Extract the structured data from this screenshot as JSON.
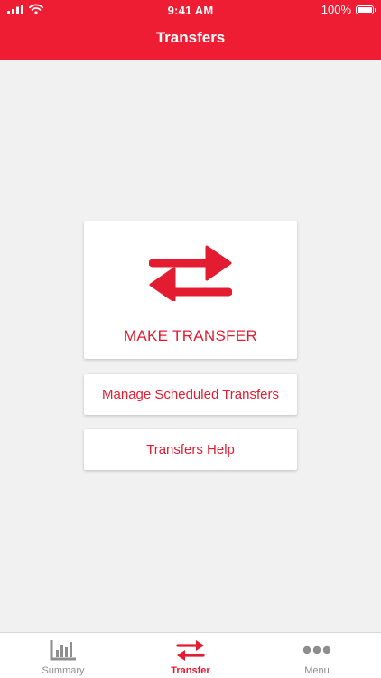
{
  "status_bar": {
    "time": "9:41 AM",
    "battery_text": "100%",
    "battery_level": 100
  },
  "header": {
    "title": "Transfers"
  },
  "actions": {
    "make_transfer": "MAKE TRANSFER",
    "manage_scheduled": "Manage Scheduled Transfers",
    "help": "Transfers Help"
  },
  "tabbar": {
    "items": [
      {
        "label": "Summary",
        "icon": "bar-chart-icon",
        "active": false
      },
      {
        "label": "Transfer",
        "icon": "transfer-arrows-icon",
        "active": true
      },
      {
        "label": "Menu",
        "icon": "more-dots-icon",
        "active": false
      }
    ]
  },
  "colors": {
    "brand_red": "#ee1d33",
    "accent_red": "#e31c31",
    "background": "#f1f1f1",
    "inactive_gray": "#8e8e8e"
  }
}
